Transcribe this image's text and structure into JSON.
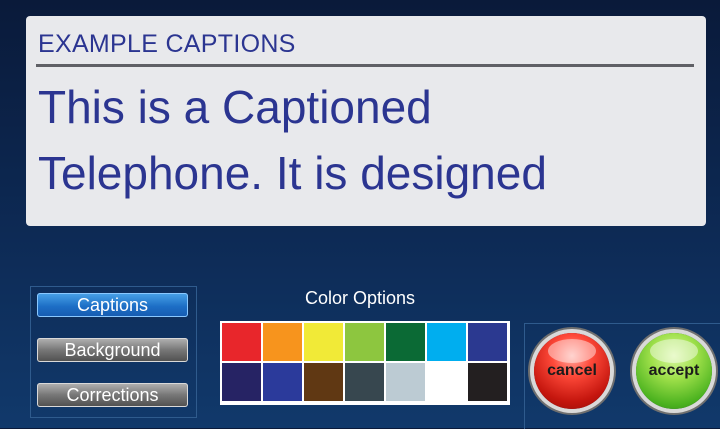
{
  "captions": {
    "header": "EXAMPLE CAPTIONS",
    "lines": [
      "This is a Captioned",
      "Telephone. It is designed"
    ]
  },
  "modes": {
    "items": [
      {
        "label": "Captions",
        "active": true
      },
      {
        "label": "Background",
        "active": false
      },
      {
        "label": "Corrections",
        "active": false
      }
    ]
  },
  "colors": {
    "title": "Color Options",
    "swatches": [
      "#e8262b",
      "#f7941d",
      "#f1ea37",
      "#8dc63f",
      "#0b6a35",
      "#00aeef",
      "#2b3990",
      "#262364",
      "#2b3a9b",
      "#603813",
      "#37474f",
      "#bccbd3",
      "#ffffff",
      "#231f20"
    ]
  },
  "actions": {
    "cancel_label": "cancel",
    "accept_label": "accept"
  }
}
